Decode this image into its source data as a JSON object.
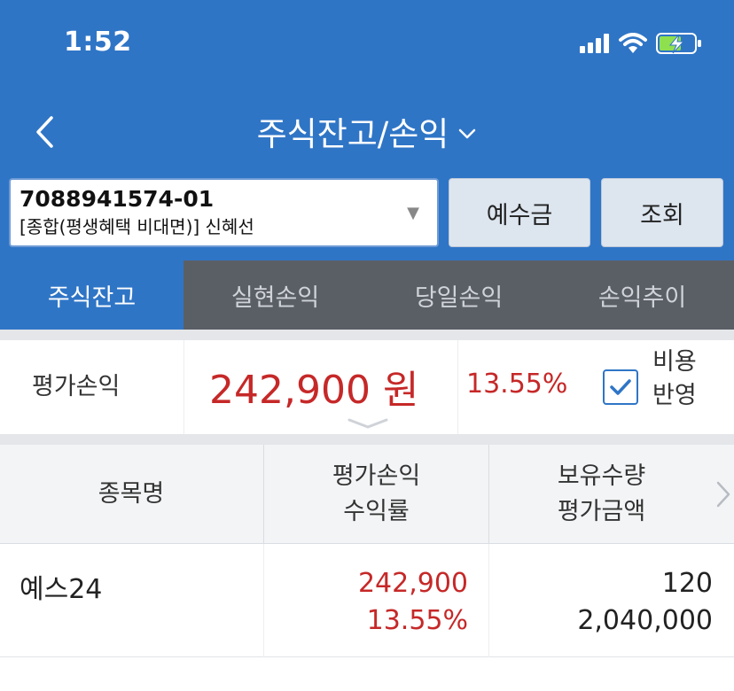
{
  "status_bar": {
    "time": "1:52"
  },
  "header": {
    "title": "주식잔고/손익",
    "account_number": "7088941574-01",
    "account_name": "[종합(평생혜택 비대면)]  신혜선",
    "deposit_button": "예수금",
    "query_button": "조회"
  },
  "tabs": [
    {
      "label": "주식잔고",
      "active": true
    },
    {
      "label": "실현손익",
      "active": false
    },
    {
      "label": "당일손익",
      "active": false
    },
    {
      "label": "손익추이",
      "active": false
    }
  ],
  "summary": {
    "label": "평가손익",
    "amount": "242,900 원",
    "rate": "13.55%",
    "checkbox_checked": true,
    "checkbox_label_line1": "비용",
    "checkbox_label_line2": "반영"
  },
  "table": {
    "columns": [
      {
        "line1": "종목명"
      },
      {
        "line1": "평가손익",
        "line2": "수익률"
      },
      {
        "line1": "보유수량",
        "line2": "평가금액"
      }
    ],
    "rows": [
      {
        "name": "예스24",
        "profit": "242,900",
        "rate": "13.55%",
        "quantity": "120",
        "value": "2,040,000"
      }
    ]
  },
  "colors": {
    "brand_blue": "#2f75c6",
    "loss_profit_red": "#c62828",
    "tab_inactive_bg": "#5a5f66"
  }
}
